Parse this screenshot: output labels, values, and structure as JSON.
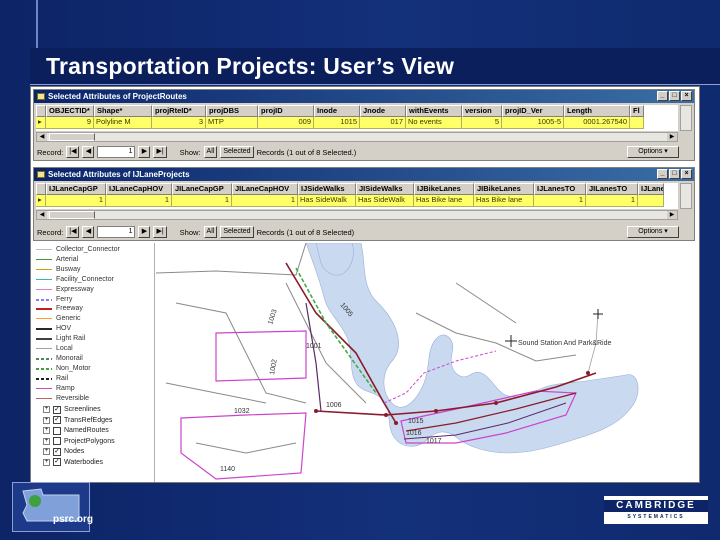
{
  "slide": {
    "title": "Transportation Projects:  User’s View",
    "colors": {
      "background": "#10296b",
      "highlight_row": "#ffff66",
      "window_title": "#0a246a"
    }
  },
  "routes_window": {
    "title": "Selected Attributes of ProjectRoutes",
    "columns": [
      "OBJECTID*",
      "Shape*",
      "projRteID*",
      "projDBS",
      "projID",
      "Inode",
      "Jnode",
      "withEvents",
      "version",
      "projID_Ver",
      "Length",
      "Fl"
    ],
    "row": [
      "9",
      "Polyline M",
      "3",
      "MTP",
      "009",
      "1015",
      "017",
      "No events",
      "5",
      "1005-5",
      "0001.267540",
      ""
    ],
    "footer": {
      "record_label": "Record:",
      "record_value": "1",
      "show_label": "Show:",
      "all_label": "All",
      "selected_label": "Selected",
      "records_text": "Records (1 out of 8 Selected.)",
      "options_label": "Options"
    }
  },
  "lanes_window": {
    "title": "Selected Attributes of IJLaneProjects",
    "columns": [
      "IJLaneCapGP",
      "IJLaneCapHOV",
      "JILaneCapGP",
      "JILaneCapHOV",
      "IJSideWalks",
      "JISideWalks",
      "IJBikeLanes",
      "JIBikeLanes",
      "IJLanesTO",
      "JILanesTO",
      "IJLanes"
    ],
    "row": [
      "1",
      "1",
      "1",
      "1",
      "Has SideWalk",
      "Has SideWalk",
      "Has Bike lane",
      "Has Bike lane",
      "1",
      "1",
      ""
    ],
    "footer": {
      "record_label": "Record:",
      "record_value": "1",
      "show_label": "Show:",
      "all_label": "All",
      "selected_label": "Selected",
      "records_text": "Records (1 out of 8 Selected)",
      "options_label": "Options"
    }
  },
  "toc": {
    "legend": [
      {
        "label": "Collector_Connector",
        "color": "#bdbdbd",
        "style": "thin"
      },
      {
        "label": "Arterial",
        "color": "#3e9a3e",
        "style": "thin"
      },
      {
        "label": "Busway",
        "color": "#d0a000",
        "style": "thin"
      },
      {
        "label": "Facility_Connector",
        "color": "#3ab0c0",
        "style": "thin"
      },
      {
        "label": "Expressway",
        "color": "#e080c0",
        "style": "thin"
      },
      {
        "label": "Ferry",
        "color": "#8080ff",
        "style": "dash"
      },
      {
        "label": "Freeway",
        "color": "#c02020",
        "style": "solid"
      },
      {
        "label": "Generic",
        "color": "#ff9a30",
        "style": "thin"
      },
      {
        "label": "HOV",
        "color": "#2a2a2a",
        "style": "solid"
      },
      {
        "label": "Light Rail",
        "color": "#404040",
        "style": "solid"
      },
      {
        "label": "Local",
        "color": "#a0a0a0",
        "style": "thin"
      },
      {
        "label": "Monorail",
        "color": "#4a8a4a",
        "style": "dash"
      },
      {
        "label": "Non_Motor",
        "color": "#40a040",
        "style": "dash"
      },
      {
        "label": "Rail",
        "color": "#202020",
        "style": "dash"
      },
      {
        "label": "Ramp",
        "color": "#c050c0",
        "style": "thin"
      },
      {
        "label": "Reversible",
        "color": "#c06060",
        "style": "thin"
      }
    ],
    "layers": [
      {
        "label": "Screenlines",
        "checked": true
      },
      {
        "label": "TransRefEdges",
        "checked": true
      },
      {
        "label": "NamedRoutes",
        "checked": false
      },
      {
        "label": "ProjectPolygons",
        "checked": false
      },
      {
        "label": "Nodes",
        "checked": true
      },
      {
        "label": "Waterbodies",
        "checked": true
      }
    ]
  },
  "map": {
    "labels": [
      "1003",
      "1001",
      "1002",
      "1032",
      "1006",
      "1005",
      "1140",
      "1015",
      "1016",
      "1017",
      "Sound Station And Park&Ride"
    ],
    "colors": {
      "water": "#c9d9f0",
      "project": "#cc44cc",
      "road": "#707070",
      "nonmotor": "#44aa44"
    }
  },
  "logos": {
    "psrc": "psrc.org",
    "cambridge": "CAMBRIDGE",
    "cambridge_sub": "SYSTEMATICS"
  }
}
